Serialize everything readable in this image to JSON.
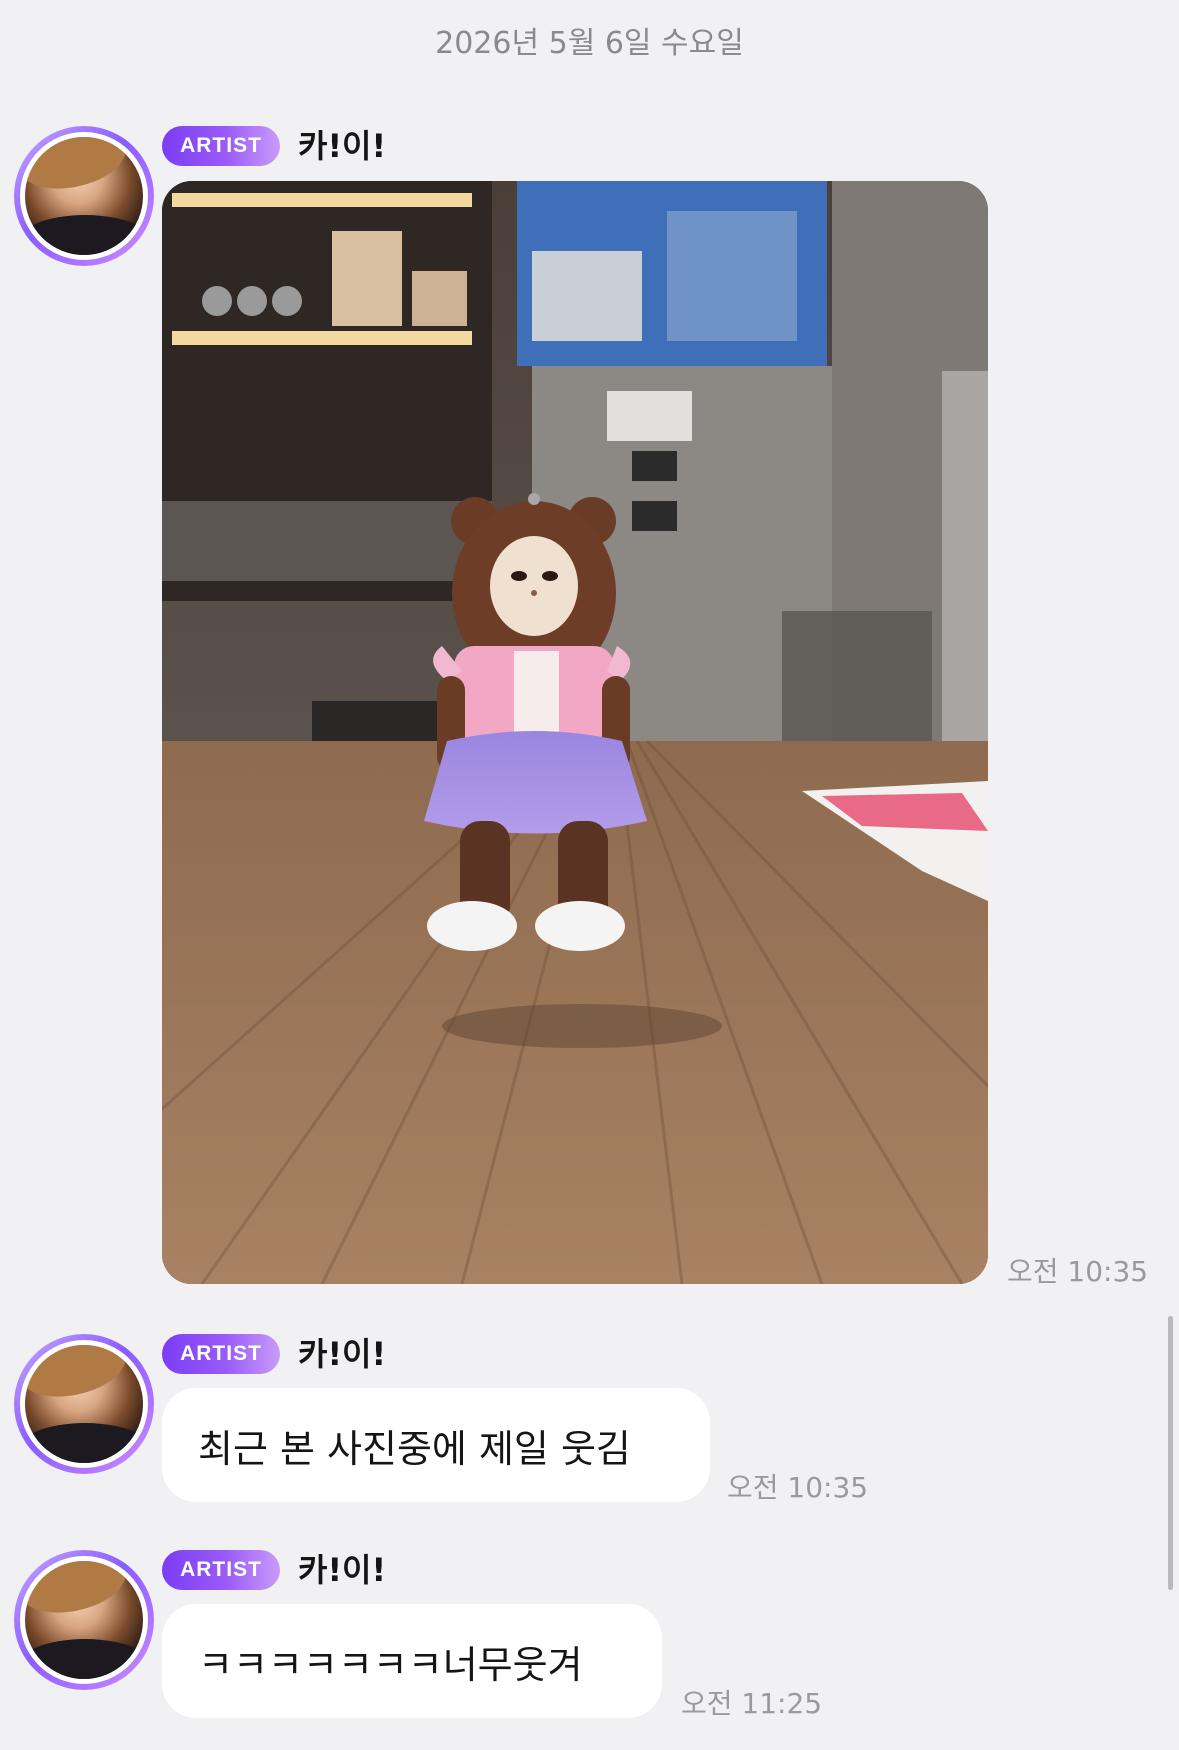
{
  "date_header": "2026년 5월 6일 수요일",
  "badge_label": "ARTIST",
  "messages": [
    {
      "sender": "카!이!",
      "type": "image",
      "image_alt": "brown bear plush doll in pink top and purple skirt standing on wooden table",
      "time": "오전 10:35"
    },
    {
      "sender": "카!이!",
      "type": "text",
      "text": "최근 본 사진중에 제일 웃김",
      "time": "오전 10:35"
    },
    {
      "sender": "카!이!",
      "type": "text",
      "text": "ㅋㅋㅋㅋㅋㅋㅋ너무웃겨",
      "time": "오전 11:25"
    }
  ],
  "colors": {
    "background": "#f1f1f3",
    "badge_gradient_start": "#7b3cf5",
    "badge_gradient_end": "#c99bf8",
    "bubble": "#ffffff",
    "timestamp": "#9a9a9e"
  }
}
